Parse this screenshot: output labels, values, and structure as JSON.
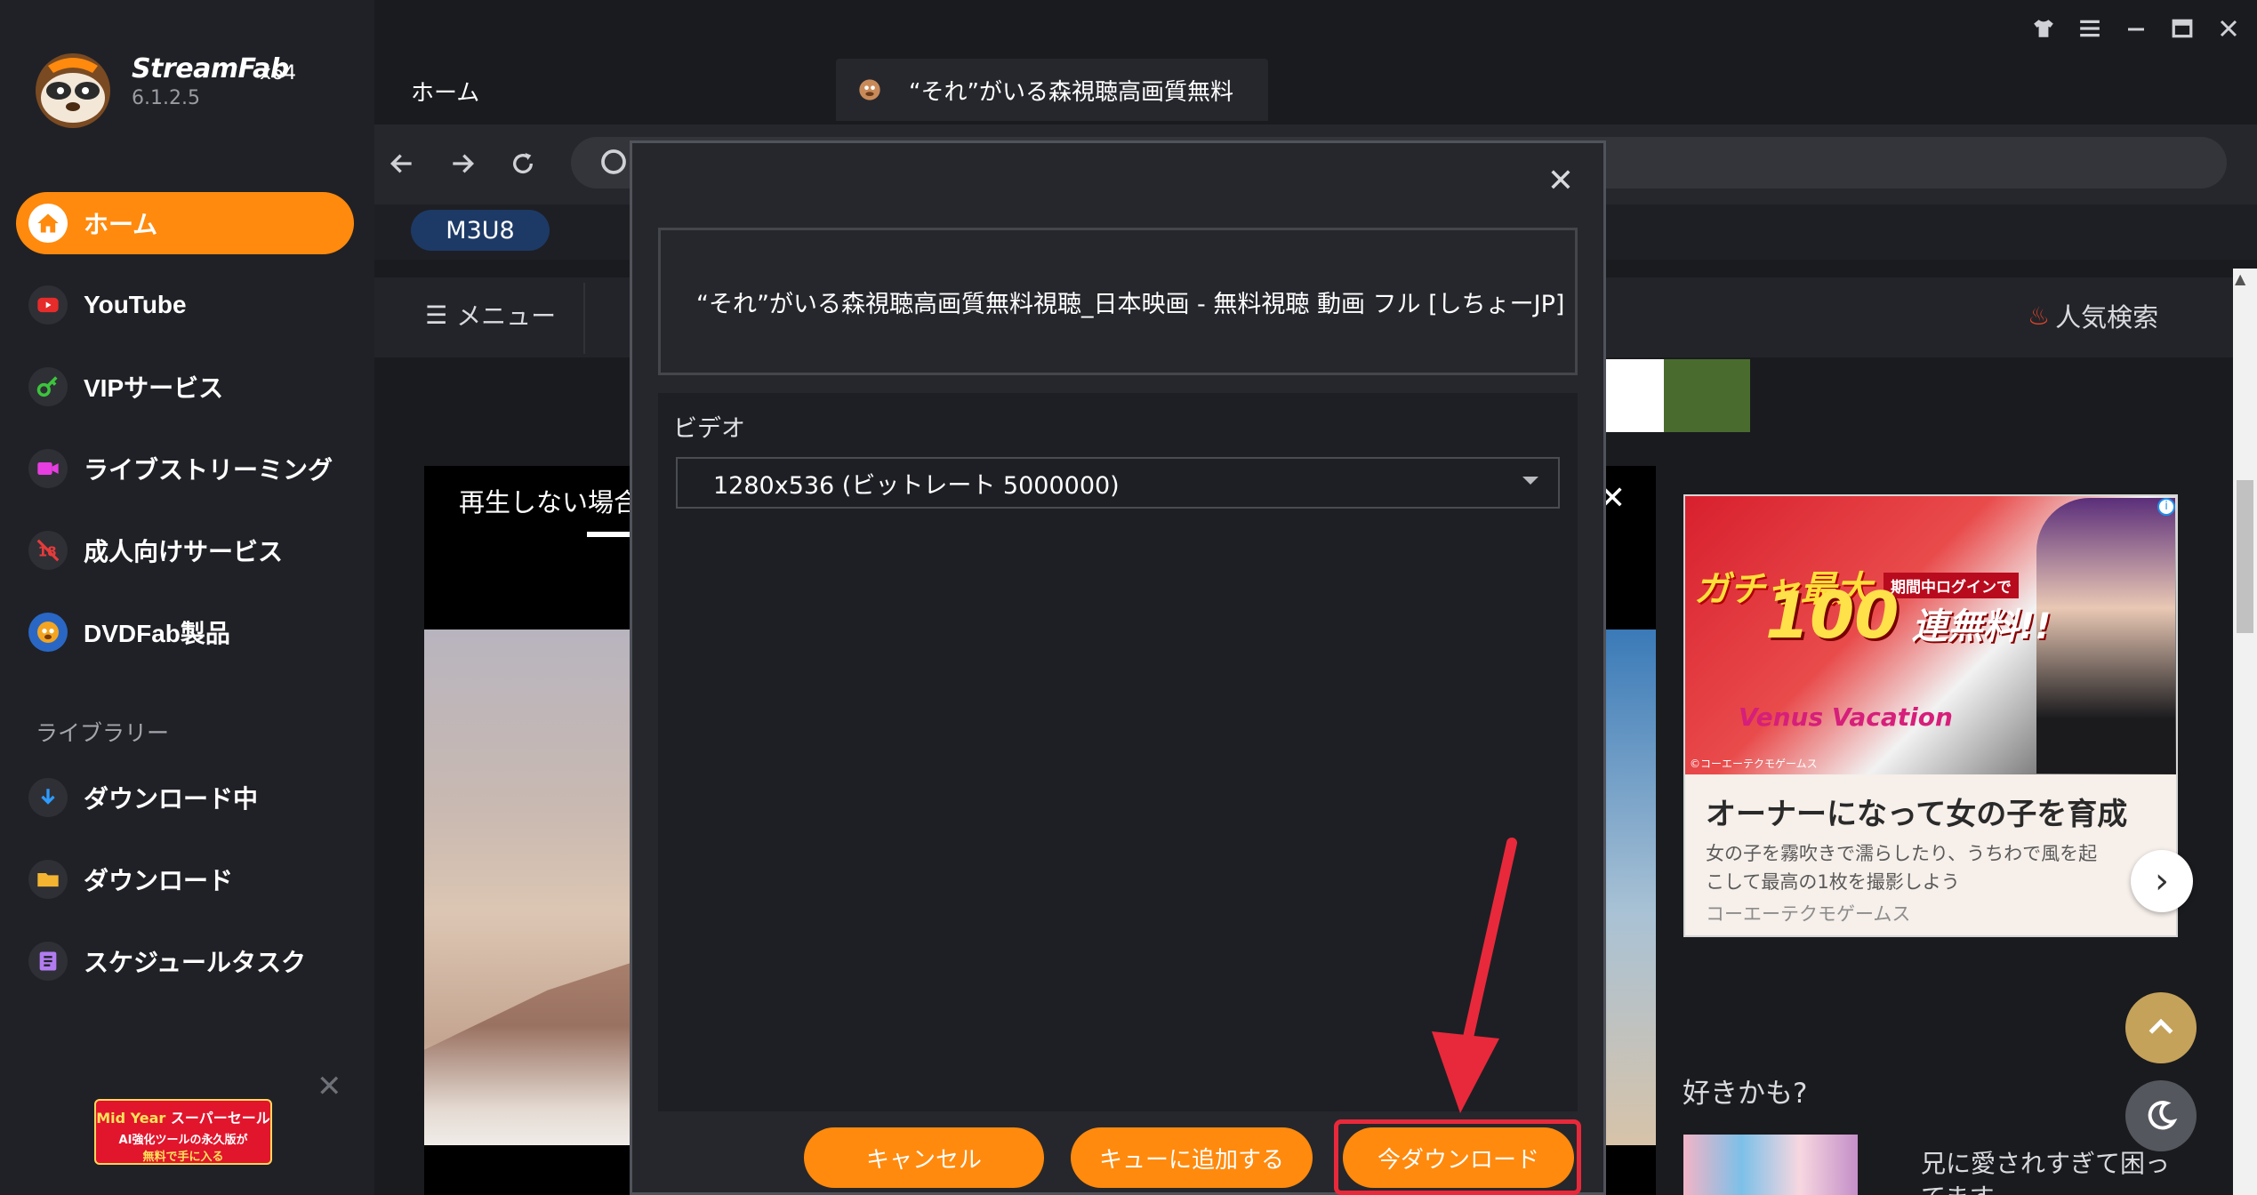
{
  "app": {
    "brand": "StreamFab",
    "arch": "x64",
    "version": "6.1.2.5"
  },
  "sidebar": {
    "items": [
      {
        "label": "ホーム",
        "icon": "home-icon",
        "active": true
      },
      {
        "label": "YouTube",
        "icon": "youtube-icon"
      },
      {
        "label": "VIPサービス",
        "icon": "key-icon"
      },
      {
        "label": "ライブストリーミング",
        "icon": "camera-icon"
      },
      {
        "label": "成人向けサービス",
        "icon": "adult-18-icon"
      },
      {
        "label": "DVDFab製品",
        "icon": "dvdfab-logo-icon"
      }
    ],
    "library_title": "ライブラリー",
    "library": [
      {
        "label": "ダウンロード中",
        "icon": "download-arrow-icon"
      },
      {
        "label": "ダウンロード",
        "icon": "folder-icon"
      },
      {
        "label": "スケジュールタスク",
        "icon": "schedule-list-icon"
      }
    ],
    "promo": {
      "line1_a": "Mid Year",
      "line1_b": "スーパーセール",
      "line2": "AI強化ツールの永久版が",
      "line3": "無料で手に入る"
    }
  },
  "tabs": {
    "home": "ホーム",
    "active_title": "“それ”がいる森視聴高画質無料"
  },
  "toolbar": {
    "tag": "M3U8"
  },
  "webpage": {
    "menu": "メニュー",
    "hot_search": "人気検索",
    "player_text": "再生しない場合",
    "ad": {
      "badge": "期間中ログインで",
      "gacha": "ガチャ最大",
      "hundred": "100",
      "free": "連無料!!",
      "game": "Venus Vacation",
      "copy": "©コーエーテクモゲームス",
      "title": "オーナーになって女の子を育成",
      "desc": "女の子を霧吹きで濡らしたり、うちわで風を起こして最高の1枚を撮影しよう",
      "company": "コーエーテクモゲームス"
    },
    "recommend_title": "好きかも?",
    "recommend_item": "兄に愛されすぎて困ってます"
  },
  "dialog": {
    "title": "“それ”がいる森視聴高画質無料視聴_日本映画 - 無料視聴 動画 フル [しちょーJP]",
    "video_label": "ビデオ",
    "video_option": "1280x536 (ビットレート 5000000)",
    "cancel": "キャンセル",
    "add_queue": "キューに追加する",
    "download_now": "今ダウンロード"
  },
  "colors": {
    "accent": "#ff8a0d",
    "highlight": "#e8293b",
    "tag_bg": "#1d3a66"
  }
}
